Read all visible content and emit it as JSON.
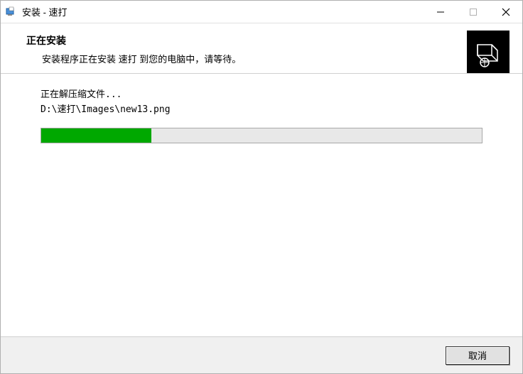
{
  "window": {
    "title": "安装 - 速打"
  },
  "header": {
    "title": "正在安装",
    "subtitle": "安装程序正在安装 速打 到您的电脑中，请等待。"
  },
  "status": {
    "line1": "正在解压缩文件...",
    "line2": "D:\\速打\\Images\\new13.png"
  },
  "progress": {
    "percent": 25
  },
  "footer": {
    "cancel_label": "取消"
  }
}
